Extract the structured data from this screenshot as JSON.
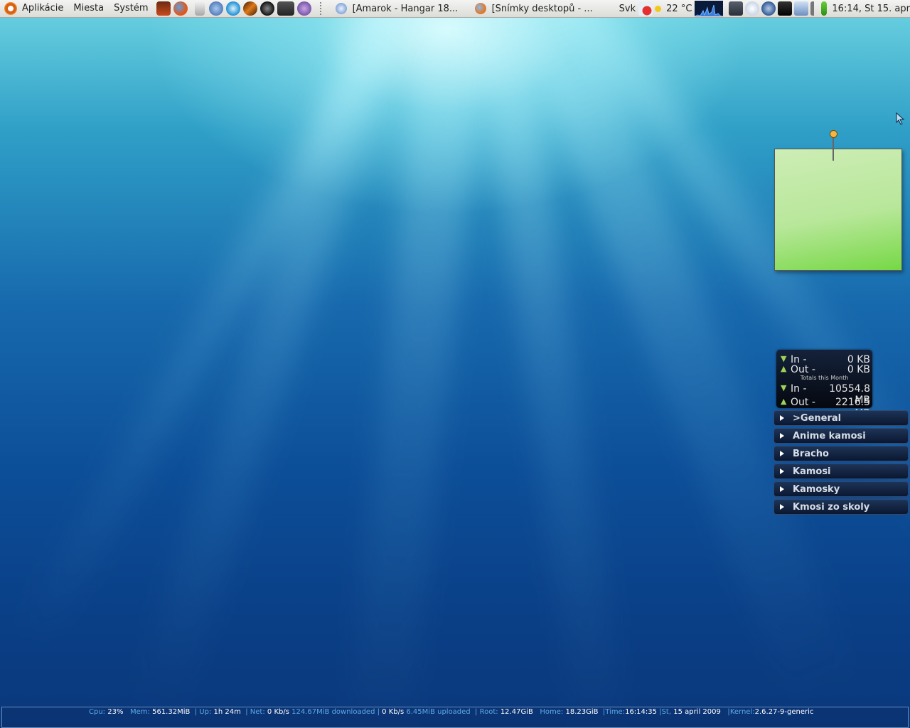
{
  "top_panel": {
    "menus": [
      "Aplikácie",
      "Miesta",
      "Systém"
    ],
    "launchers": [
      "game-launcher-icon",
      "firefox-icon",
      "trash-icon",
      "thunderbird-icon",
      "skype-icon",
      "terminal-orange-icon",
      "player-icon",
      "console-icon",
      "pidgin-icon"
    ],
    "tasks": [
      {
        "label": "[Amarok - Hangar 18..."
      },
      {
        "label": "[Snímky desktopů - ..."
      }
    ],
    "keyboard_layout": "Svk",
    "temperature": "22 °C",
    "clock": "16:14, St 15. apr"
  },
  "note": {},
  "net_monitor": {
    "in_now": {
      "label": "In -",
      "value": "0 KB"
    },
    "out_now": {
      "label": "Out -",
      "value": "0 KB"
    },
    "totals_label": "Totals this Month",
    "in_month": {
      "label": "In -",
      "value": "10554.8 MB"
    },
    "out_month": {
      "label": "Out -",
      "value": "2216.5 MB"
    }
  },
  "contact_groups": [
    ">General",
    "Anime kamosi",
    "Bracho",
    "Kamosi",
    "Kamosky",
    "Kmosi zo skoly"
  ],
  "conky": {
    "cpu_k": "Cpu:",
    "cpu_v": "23%",
    "mem_k": "Mem:",
    "mem_v": "561.32MiB",
    "up_k": "Up:",
    "up_v": "1h 24m",
    "net_k": "Net:",
    "net_down": "0 Kb/s",
    "downloaded": "124.67MiB downloaded |",
    "net_up": "0 Kb/s",
    "uploaded": "6.45MiB uploaded",
    "root_k": "Root:",
    "root_v": "12.47GiB",
    "home_k": "Home:",
    "home_v": "18.23GiB",
    "time_k": "Time:",
    "time_v": "16:14:35",
    "date_k": "St,",
    "date_v": "15 april 2009",
    "kernel_k": "Kernel:",
    "kernel_v": "2.6.27-9-generic"
  },
  "colors": {
    "accent": "#5fa9e6",
    "note": "#b8e79a",
    "panel": "#e8e8e4"
  }
}
